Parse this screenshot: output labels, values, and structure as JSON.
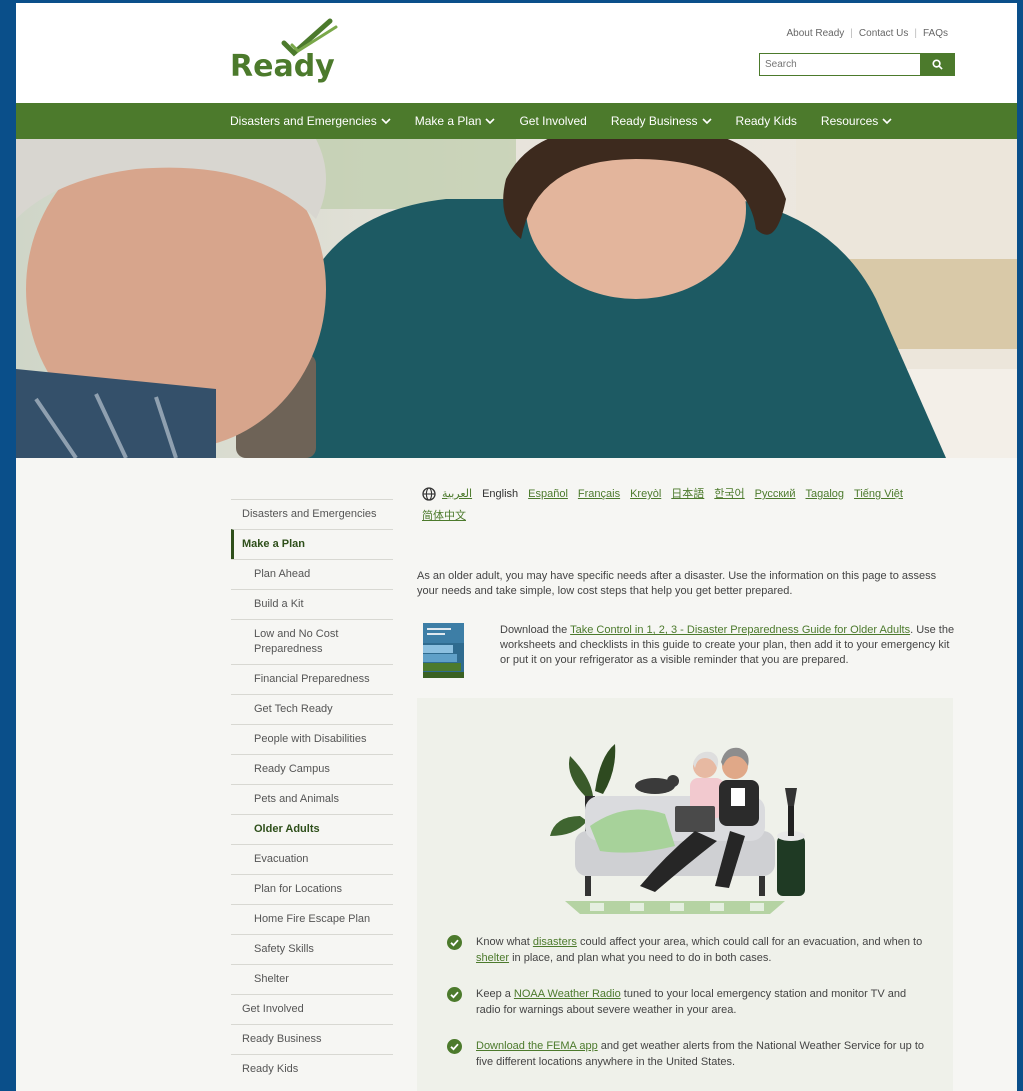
{
  "header": {
    "logo_text": "Ready",
    "util_links": [
      "About Ready",
      "Contact Us",
      "FAQs"
    ],
    "search_placeholder": "Search"
  },
  "nav": {
    "items": [
      {
        "label": "Disasters and Emergencies",
        "dropdown": true
      },
      {
        "label": "Make a Plan",
        "dropdown": true
      },
      {
        "label": "Get Involved",
        "dropdown": false
      },
      {
        "label": "Ready Business",
        "dropdown": true
      },
      {
        "label": "Ready Kids",
        "dropdown": false
      },
      {
        "label": "Resources",
        "dropdown": true
      }
    ]
  },
  "sidebar": {
    "top_item": "Disasters and Emergencies",
    "active_item": "Make a Plan",
    "sub_items": [
      "Plan Ahead",
      "Build a Kit",
      "Low and No Cost Preparedness",
      "Financial Preparedness",
      "Get Tech Ready",
      "People with Disabilities",
      "Ready Campus",
      "Pets and Animals",
      "Older Adults",
      "Evacuation",
      "Plan for Locations",
      "Home Fire Escape Plan",
      "Safety Skills",
      "Shelter"
    ],
    "current_sub": "Older Adults",
    "bottom_items": [
      "Get Involved",
      "Ready Business",
      "Ready Kids"
    ]
  },
  "content": {
    "languages": [
      "العربية",
      "English",
      "Español",
      "Français",
      "Kreyòl",
      "日本語",
      "한국어",
      "Русский",
      "Tagalog",
      "Tiếng Việt",
      "简体中文"
    ],
    "current_language": "English",
    "intro": "As an older adult, you may have specific needs after a disaster. Use the information on this page to assess your needs and take simple, low cost steps that help you get better prepared.",
    "guide_prefix": "Download the ",
    "guide_link": "Take Control in 1, 2, 3 - Disaster Preparedness Guide for Older Adults",
    "guide_suffix": ". Use the worksheets and checklists in this guide to create your plan, then add it to your emergency kit or put it on your refrigerator as a visible reminder that you are prepared.",
    "checks": [
      {
        "a": "Know what ",
        "link1": "disasters",
        "b": " could affect your area, which could call for an evacuation, and when to ",
        "link2": "shelter",
        "c": " in place, and plan what you need to do in both cases."
      },
      {
        "a": "Keep a ",
        "link1": "NOAA Weather Radio",
        "b": " tuned to your local emergency station and monitor TV and radio for warnings about severe weather in your area.",
        "link2": "",
        "c": ""
      },
      {
        "a": "",
        "link1": "Download the FEMA app",
        "b": " and get weather alerts from the National Weather Service for up to five different locations anywhere in the United States.",
        "link2": "",
        "c": ""
      }
    ]
  },
  "colors": {
    "brand_green": "#4c7a2c",
    "dark_green": "#2e4f1a",
    "frame_blue": "#0a4f8a"
  }
}
